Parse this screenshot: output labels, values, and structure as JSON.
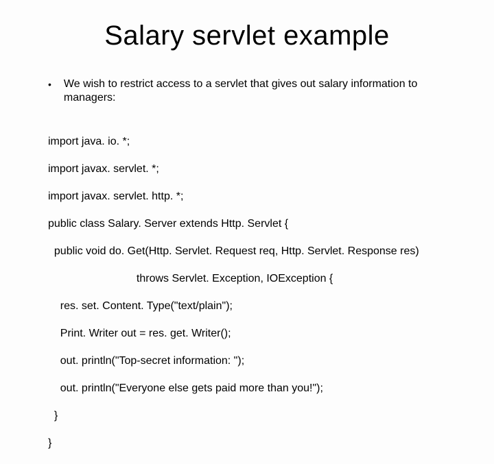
{
  "title": "Salary servlet example",
  "bullet": {
    "marker": "•",
    "text": "We wish to restrict access to a servlet that gives out salary information to managers:"
  },
  "code": {
    "l1": "import java. io. *;",
    "l2": "import javax. servlet. *;",
    "l3": "import javax. servlet. http. *;",
    "l4": "public class Salary. Server extends Http. Servlet {",
    "l5": "  public void do. Get(Http. Servlet. Request req, Http. Servlet. Response res)",
    "l6": "                             throws Servlet. Exception, IOException {",
    "l7": "    res. set. Content. Type(\"text/plain\");",
    "l8": "    Print. Writer out = res. get. Writer();",
    "l9": "    out. println(\"Top-secret information: \");",
    "l10": "    out. println(\"Everyone else gets paid more than you!\");",
    "l11": "  }",
    "l12": "}"
  }
}
